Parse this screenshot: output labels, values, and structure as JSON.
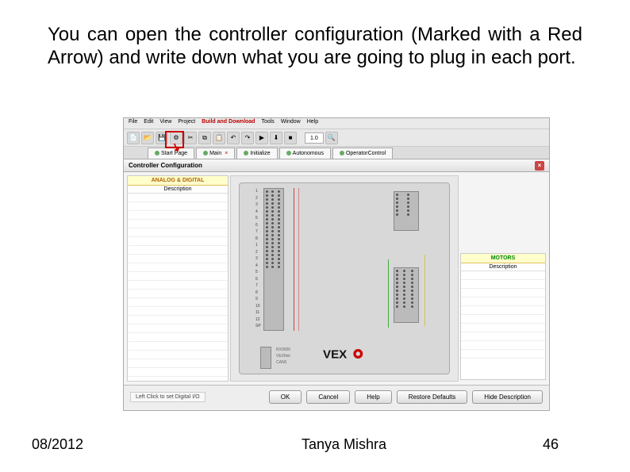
{
  "slide": {
    "text": "You can open the controller configuration (Marked with a Red Arrow) and write down what you are going to plug in each port.",
    "date": "08/2012",
    "author": "Tanya Mishra",
    "page": "46"
  },
  "menubar": {
    "items": [
      "File",
      "Edit",
      "View",
      "Project",
      "Build and Download",
      "Tools",
      "Window",
      "Help"
    ]
  },
  "toolbar": {
    "zoom": "1.0"
  },
  "tabs": {
    "items": [
      "Start Page",
      "Main",
      "Initialize",
      "Autonomous",
      "OperatorControl"
    ]
  },
  "config": {
    "title": "Controller Configuration",
    "left_panel_title": "ANALOG & DIGITAL",
    "left_panel_sub": "Description",
    "right_panel_title": "MOTORS",
    "right_panel_sub": "Description"
  },
  "connectors": {
    "lines": [
      "RX0000",
      "VEXNet",
      "CAN0"
    ]
  },
  "buttons": {
    "hint": "Left Click to set Digital I/O",
    "ok": "OK",
    "cancel": "Cancel",
    "help": "Help",
    "restore": "Restore Defaults",
    "hide": "Hide Description"
  },
  "port_labels": [
    "1",
    "2",
    "3",
    "4",
    "5",
    "6",
    "7",
    "8",
    "1",
    "2",
    "3",
    "4",
    "5",
    "6",
    "7",
    "8",
    "9",
    "10",
    "11",
    "12",
    "SP"
  ]
}
